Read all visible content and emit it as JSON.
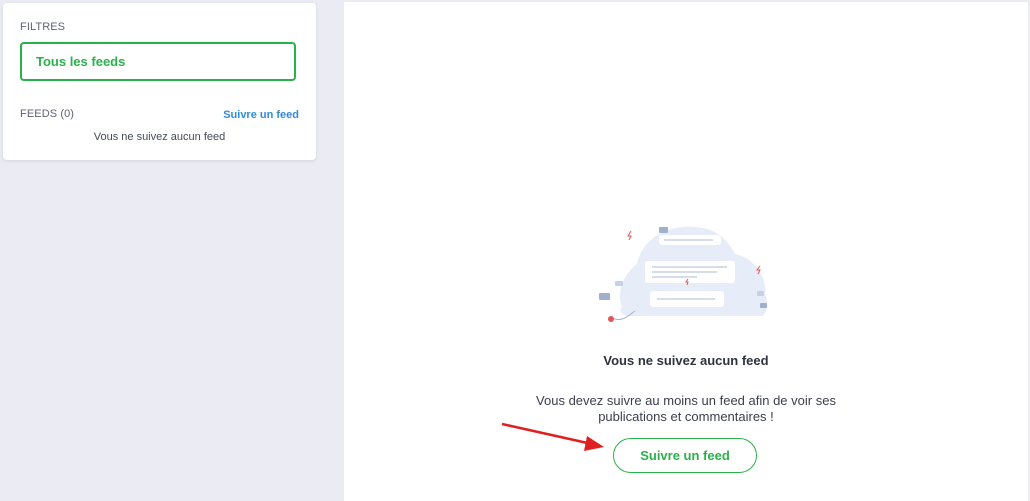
{
  "sidebar": {
    "filters_title": "FILTRES",
    "filter_all_label": "Tous les feeds",
    "feeds_title": "FEEDS (0)",
    "follow_link_label": "Suivre un feed",
    "empty_text": "Vous ne suivez aucun feed"
  },
  "main": {
    "empty_title": "Vous ne suivez aucun feed",
    "empty_description": "Vous devez suivre au moins un feed afin de voir ses publications et commentaires !",
    "follow_button_label": "Suivre un feed",
    "illustration_icon": "empty-feed-illustration"
  },
  "colors": {
    "accent_green": "#2ab24a",
    "link_blue": "#2f8ae0",
    "annotation_red": "#e02020",
    "background": "#ebebf3"
  }
}
